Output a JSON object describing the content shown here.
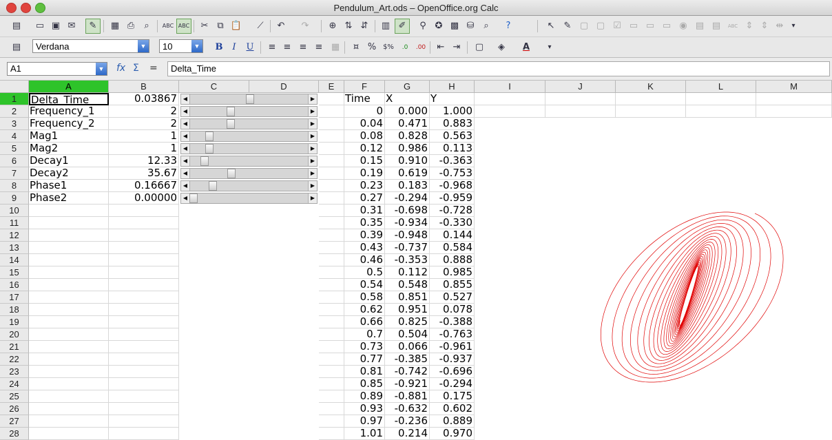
{
  "window": {
    "title": "Pendulum_Art.ods – OpenOffice.org Calc"
  },
  "toolbar2": {
    "font_name": "Verdana",
    "font_size": "10"
  },
  "formula_bar": {
    "name_box": "A1",
    "content": "Delta_Time"
  },
  "columns": [
    "A",
    "B",
    "C",
    "D",
    "E",
    "F",
    "G",
    "H",
    "I",
    "J",
    "K",
    "L",
    "M"
  ],
  "rows": [
    "1",
    "2",
    "3",
    "4",
    "5",
    "6",
    "7",
    "8",
    "9",
    "10",
    "11",
    "12",
    "13",
    "14",
    "15",
    "16",
    "17",
    "18",
    "19",
    "20",
    "21",
    "22",
    "23",
    "24",
    "25",
    "26",
    "27",
    "28"
  ],
  "parameters": [
    {
      "label": "Delta_Time",
      "value": "0.03867",
      "slider": 0.5
    },
    {
      "label": "Frequency_1",
      "value": "2",
      "slider": 0.33
    },
    {
      "label": "Frequency_2",
      "value": "2",
      "slider": 0.33
    },
    {
      "label": "Mag1",
      "value": "1",
      "slider": 0.14
    },
    {
      "label": "Mag2",
      "value": "1",
      "slider": 0.14
    },
    {
      "label": "Decay1",
      "value": "12.33",
      "slider": 0.1
    },
    {
      "label": "Decay2",
      "value": "35.67",
      "slider": 0.34
    },
    {
      "label": "Phase1",
      "value": "0.16667",
      "slider": 0.17
    },
    {
      "label": "Phase2",
      "value": "0.00000",
      "slider": 0.0
    }
  ],
  "table": {
    "headers": [
      "Time",
      "X",
      "Y"
    ],
    "rows": [
      [
        "0",
        "0.000",
        "1.000"
      ],
      [
        "0.04",
        "0.471",
        "0.883"
      ],
      [
        "0.08",
        "0.828",
        "0.563"
      ],
      [
        "0.12",
        "0.986",
        "0.113"
      ],
      [
        "0.15",
        "0.910",
        "-0.363"
      ],
      [
        "0.19",
        "0.619",
        "-0.753"
      ],
      [
        "0.23",
        "0.183",
        "-0.968"
      ],
      [
        "0.27",
        "-0.294",
        "-0.959"
      ],
      [
        "0.31",
        "-0.698",
        "-0.728"
      ],
      [
        "0.35",
        "-0.934",
        "-0.330"
      ],
      [
        "0.39",
        "-0.948",
        "0.144"
      ],
      [
        "0.43",
        "-0.737",
        "0.584"
      ],
      [
        "0.46",
        "-0.353",
        "0.888"
      ],
      [
        "0.5",
        "0.112",
        "0.985"
      ],
      [
        "0.54",
        "0.548",
        "0.855"
      ],
      [
        "0.58",
        "0.851",
        "0.527"
      ],
      [
        "0.62",
        "0.951",
        "0.078"
      ],
      [
        "0.66",
        "0.825",
        "-0.388"
      ],
      [
        "0.7",
        "0.504",
        "-0.763"
      ],
      [
        "0.73",
        "0.066",
        "-0.961"
      ],
      [
        "0.77",
        "-0.385",
        "-0.937"
      ],
      [
        "0.81",
        "-0.742",
        "-0.696"
      ],
      [
        "0.85",
        "-0.921",
        "-0.294"
      ],
      [
        "0.89",
        "-0.881",
        "0.175"
      ],
      [
        "0.93",
        "-0.632",
        "0.602"
      ],
      [
        "0.97",
        "-0.236",
        "0.889"
      ],
      [
        "1.01",
        "0.214",
        "0.970"
      ]
    ]
  },
  "chart_data": {
    "type": "line",
    "series": [
      {
        "parameters": {
          "delta_time": 0.03867,
          "frequency_1": 2,
          "frequency_2": 2,
          "mag1": 1,
          "mag2": 1,
          "decay1": 12.33,
          "decay2": 35.67,
          "phase1": 0.16667,
          "phase2": 0.0
        }
      }
    ],
    "color": "#e00000",
    "grid": false,
    "legend": "none"
  },
  "colors": {
    "selection": "#2ec32a",
    "curve": "#e00000"
  }
}
